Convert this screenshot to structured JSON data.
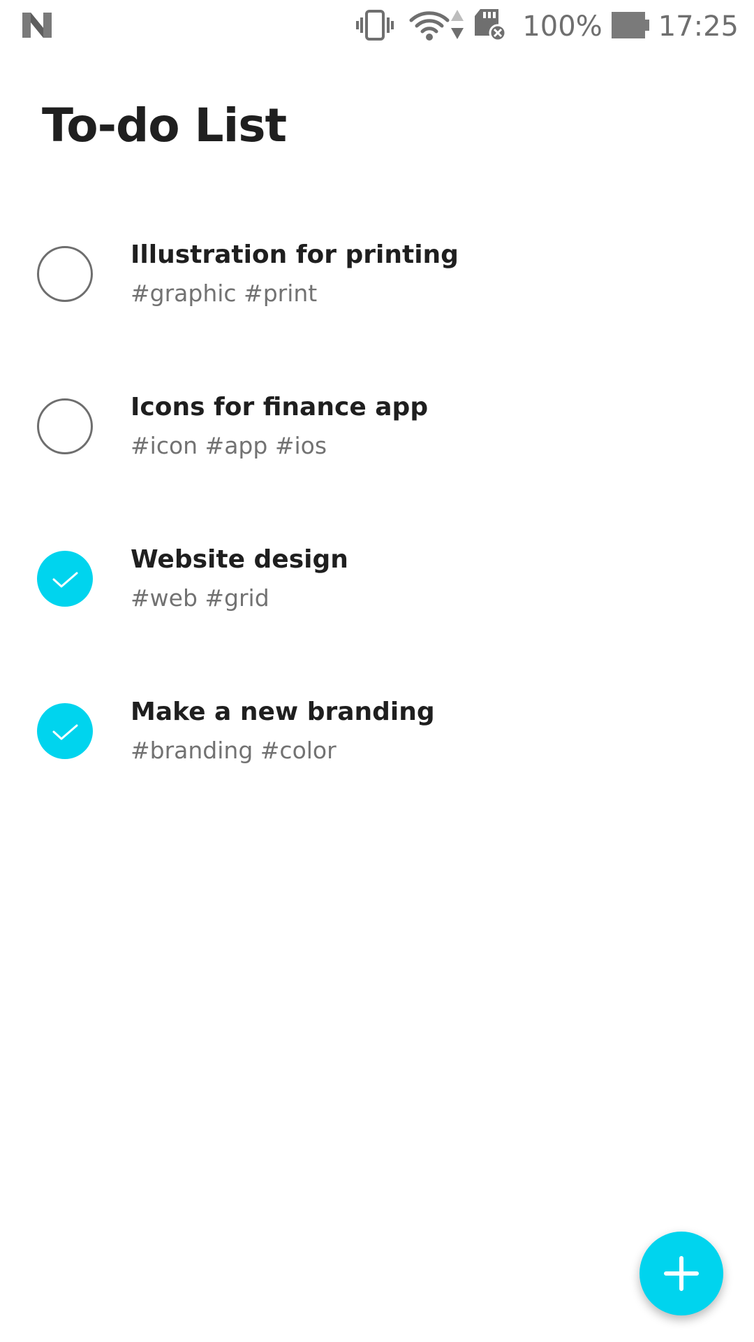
{
  "status_bar": {
    "battery_text": "100%",
    "time": "17:25",
    "icons": [
      "n-logo-icon",
      "vibrate-icon",
      "wifi-icon",
      "data-arrows-icon",
      "sd-card-icon",
      "battery-icon"
    ]
  },
  "title": "To-do List",
  "accent_color": "#00d4ee",
  "tasks": [
    {
      "title": "Illustration for printing",
      "tags": "#graphic #print",
      "done": false
    },
    {
      "title": "Icons for finance app",
      "tags": "#icon #app #ios",
      "done": false
    },
    {
      "title": "Website design",
      "tags": "#web #grid",
      "done": true
    },
    {
      "title": "Make a new branding",
      "tags": "#branding #color",
      "done": true
    }
  ],
  "fab": {
    "icon": "plus-icon"
  }
}
